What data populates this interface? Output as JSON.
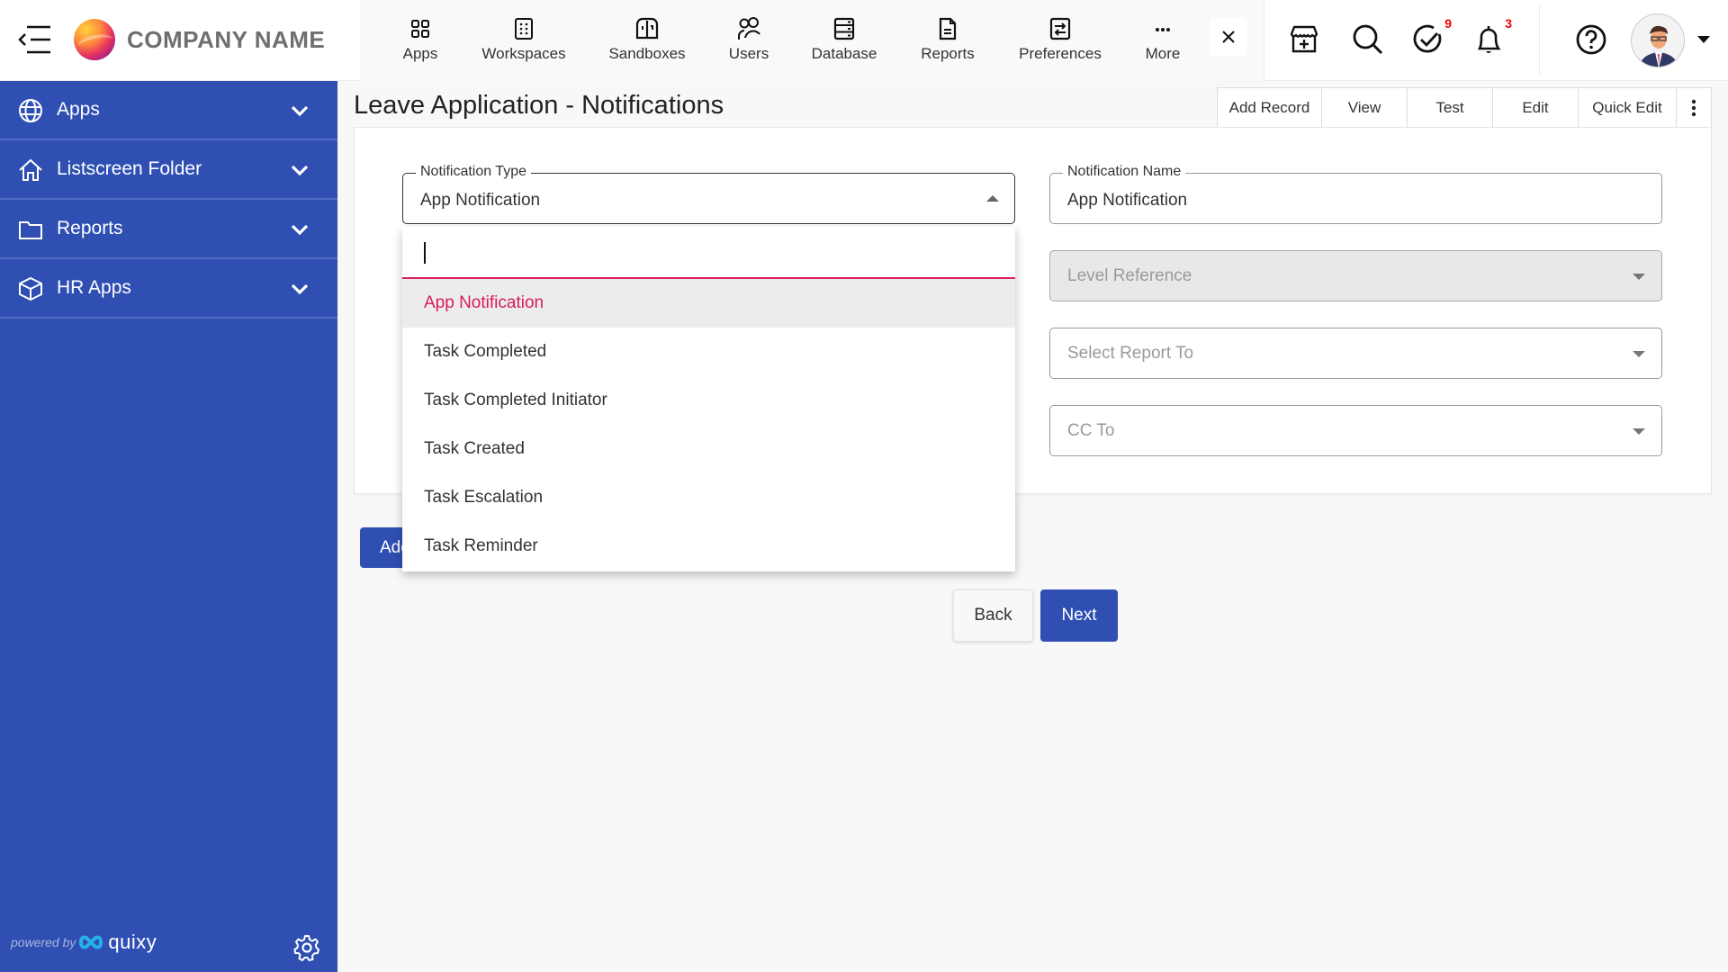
{
  "header": {
    "company_name": "COMPANY NAME",
    "nav": [
      {
        "label": "Apps",
        "icon": "apps-grid-icon"
      },
      {
        "label": "Workspaces",
        "icon": "workspaces-icon"
      },
      {
        "label": "Sandboxes",
        "icon": "sandboxes-icon"
      },
      {
        "label": "Users",
        "icon": "users-icon"
      },
      {
        "label": "Database",
        "icon": "database-icon"
      },
      {
        "label": "Reports",
        "icon": "reports-icon"
      },
      {
        "label": "Preferences",
        "icon": "preferences-icon"
      },
      {
        "label": "More",
        "icon": "more-dots-icon"
      }
    ],
    "tasks_badge": "9",
    "notifications_badge": "3"
  },
  "sidebar": {
    "items": [
      {
        "label": "Apps",
        "icon": "globe-icon"
      },
      {
        "label": "Listscreen Folder",
        "icon": "home-icon"
      },
      {
        "label": "Reports",
        "icon": "folder-icon"
      },
      {
        "label": "HR Apps",
        "icon": "cube-icon"
      }
    ],
    "powered_by": "powered by",
    "powered_brand": "quixy"
  },
  "page": {
    "title": "Leave Application - Notifications",
    "toolbar": [
      "Add Record",
      "View",
      "Test",
      "Edit",
      "Quick Edit"
    ]
  },
  "form": {
    "notification_type": {
      "label": "Notification Type",
      "value": "App Notification"
    },
    "notification_name": {
      "label": "Notification Name",
      "value": "App Notification"
    },
    "level_reference": {
      "placeholder": "Level Reference",
      "disabled": true
    },
    "report_to": {
      "placeholder": "Select Report To"
    },
    "cc_to": {
      "placeholder": "CC To"
    }
  },
  "dropdown": {
    "search_value": "",
    "options": [
      "App Notification",
      "Task Completed",
      "Task Completed Initiator",
      "Task Created",
      "Task Escalation",
      "Task Reminder"
    ],
    "selected": "App Notification",
    "accent_color": "#d81b60"
  },
  "buttons": {
    "add": "Add",
    "back": "Back",
    "next": "Next"
  },
  "colors": {
    "primary": "#2f4fb3",
    "badge": "#e00000"
  }
}
